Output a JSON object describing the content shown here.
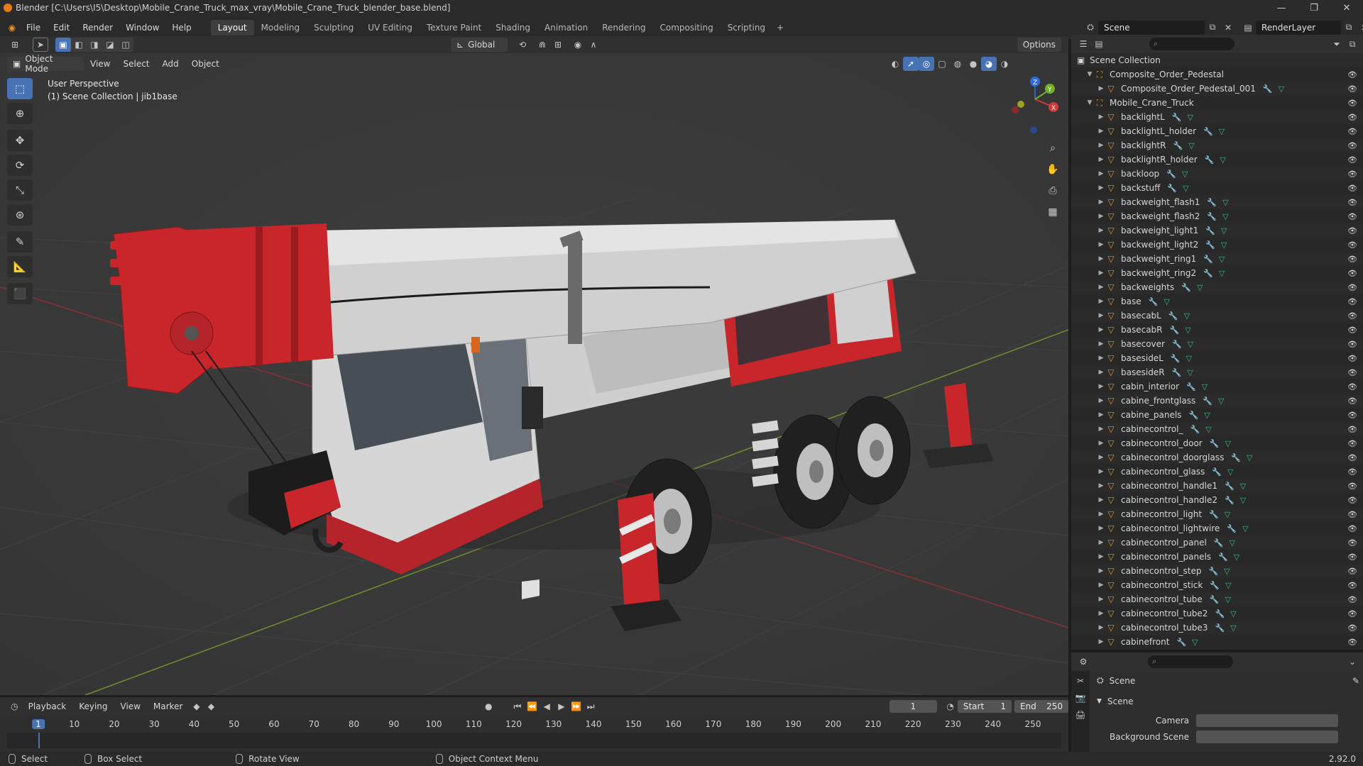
{
  "window": {
    "title": "Blender [C:\\Users\\I5\\Desktop\\Mobile_Crane_Truck_max_vray\\Mobile_Crane_Truck_blender_base.blend]",
    "minimize": "—",
    "maximize": "❐",
    "close": "✕"
  },
  "menu": [
    "File",
    "Edit",
    "Render",
    "Window",
    "Help"
  ],
  "workspaces": [
    "Layout",
    "Modeling",
    "Sculpting",
    "UV Editing",
    "Texture Paint",
    "Shading",
    "Animation",
    "Rendering",
    "Compositing",
    "Scripting"
  ],
  "active_workspace": "Layout",
  "scene_field": "Scene",
  "renderlayer_field": "RenderLayer",
  "tool_header": {
    "transform_orientation": "Global",
    "options_label": "Options"
  },
  "viewport_header": {
    "mode": "Object Mode",
    "menus": [
      "View",
      "Select",
      "Add",
      "Object"
    ]
  },
  "viewport": {
    "perspective": "User Perspective",
    "collection_info": "(1) Scene Collection | jib1base",
    "gizmo": {
      "x": "X",
      "y": "Y",
      "z": "Z"
    }
  },
  "outliner": {
    "root": "Scene Collection",
    "rows": [
      {
        "name": "Composite_Order_Pedestal",
        "level": 1,
        "kind": "collection"
      },
      {
        "name": "Composite_Order_Pedestal_001",
        "level": 2,
        "kind": "object"
      },
      {
        "name": "Mobile_Crane_Truck",
        "level": 1,
        "kind": "collection"
      },
      {
        "name": "backlightL",
        "level": 2,
        "kind": "object"
      },
      {
        "name": "backlightL_holder",
        "level": 2,
        "kind": "object"
      },
      {
        "name": "backlightR",
        "level": 2,
        "kind": "object"
      },
      {
        "name": "backlightR_holder",
        "level": 2,
        "kind": "object"
      },
      {
        "name": "backloop",
        "level": 2,
        "kind": "object"
      },
      {
        "name": "backstuff",
        "level": 2,
        "kind": "object"
      },
      {
        "name": "backweight_flash1",
        "level": 2,
        "kind": "object"
      },
      {
        "name": "backweight_flash2",
        "level": 2,
        "kind": "object"
      },
      {
        "name": "backweight_light1",
        "level": 2,
        "kind": "object"
      },
      {
        "name": "backweight_light2",
        "level": 2,
        "kind": "object"
      },
      {
        "name": "backweight_ring1",
        "level": 2,
        "kind": "object"
      },
      {
        "name": "backweight_ring2",
        "level": 2,
        "kind": "object"
      },
      {
        "name": "backweights",
        "level": 2,
        "kind": "object"
      },
      {
        "name": "base",
        "level": 2,
        "kind": "object"
      },
      {
        "name": "basecabL",
        "level": 2,
        "kind": "object"
      },
      {
        "name": "basecabR",
        "level": 2,
        "kind": "object"
      },
      {
        "name": "basecover",
        "level": 2,
        "kind": "object"
      },
      {
        "name": "basesideL",
        "level": 2,
        "kind": "object"
      },
      {
        "name": "basesideR",
        "level": 2,
        "kind": "object"
      },
      {
        "name": "cabin_interior",
        "level": 2,
        "kind": "object"
      },
      {
        "name": "cabine_frontglass",
        "level": 2,
        "kind": "object"
      },
      {
        "name": "cabine_panels",
        "level": 2,
        "kind": "object"
      },
      {
        "name": "cabinecontrol_",
        "level": 2,
        "kind": "object"
      },
      {
        "name": "cabinecontrol_door",
        "level": 2,
        "kind": "object"
      },
      {
        "name": "cabinecontrol_doorglass",
        "level": 2,
        "kind": "object"
      },
      {
        "name": "cabinecontrol_glass",
        "level": 2,
        "kind": "object"
      },
      {
        "name": "cabinecontrol_handle1",
        "level": 2,
        "kind": "object"
      },
      {
        "name": "cabinecontrol_handle2",
        "level": 2,
        "kind": "object"
      },
      {
        "name": "cabinecontrol_light",
        "level": 2,
        "kind": "object"
      },
      {
        "name": "cabinecontrol_lightwire",
        "level": 2,
        "kind": "object"
      },
      {
        "name": "cabinecontrol_panel",
        "level": 2,
        "kind": "object"
      },
      {
        "name": "cabinecontrol_panels",
        "level": 2,
        "kind": "object"
      },
      {
        "name": "cabinecontrol_step",
        "level": 2,
        "kind": "object"
      },
      {
        "name": "cabinecontrol_stick",
        "level": 2,
        "kind": "object"
      },
      {
        "name": "cabinecontrol_tube",
        "level": 2,
        "kind": "object"
      },
      {
        "name": "cabinecontrol_tube2",
        "level": 2,
        "kind": "object"
      },
      {
        "name": "cabinecontrol_tube3",
        "level": 2,
        "kind": "object"
      },
      {
        "name": "cabinefront",
        "level": 2,
        "kind": "object"
      }
    ]
  },
  "properties": {
    "context": "Scene",
    "panel": "Scene",
    "camera_label": "Camera",
    "background_scene_label": "Background Scene"
  },
  "timeline": {
    "menus": [
      "Playback",
      "Keying",
      "View",
      "Marker"
    ],
    "current_frame": "1",
    "start_label": "Start",
    "start": "1",
    "end_label": "End",
    "end": "250",
    "ticks": [
      "1",
      "10",
      "20",
      "30",
      "40",
      "50",
      "60",
      "70",
      "80",
      "90",
      "100",
      "110",
      "120",
      "130",
      "140",
      "150",
      "160",
      "170",
      "180",
      "190",
      "200",
      "210",
      "220",
      "230",
      "240",
      "250"
    ]
  },
  "statusbar": {
    "select": "Select",
    "box_select": "Box Select",
    "rotate_view": "Rotate View",
    "context_menu": "Object Context Menu",
    "version": "2.92.0"
  },
  "colors": {
    "accent": "#4772b3",
    "crane_red": "#c8262a",
    "crane_white": "#d8d8d8",
    "object_icon": "#e8902a",
    "mesh_icon": "#3fb58e",
    "modifier_icon": "#6f9be0"
  }
}
